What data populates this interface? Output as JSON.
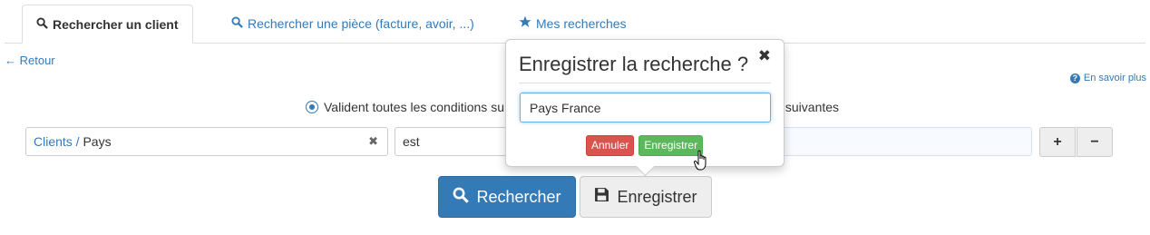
{
  "tabs": [
    {
      "label": "Rechercher un client",
      "icon": "search-icon",
      "active": true
    },
    {
      "label": "Rechercher une pièce (facture, avoir, ...)",
      "icon": "search-icon",
      "active": false
    },
    {
      "label": "Mes recherches",
      "icon": "star-icon",
      "active": false
    }
  ],
  "back_link": "← Retour",
  "help_link": "En savoir plus",
  "conditions": {
    "text_left": "Valident toutes les conditions su",
    "text_right": "s suivantes"
  },
  "criteria_row": {
    "field_link": "Clients",
    "field_sep": " / ",
    "field_name": "Pays",
    "clear_symbol": "✖",
    "operator": "est",
    "plus_label": "+",
    "minus_label": "−"
  },
  "actions": {
    "search_label": "Rechercher",
    "save_label": "Enregistrer"
  },
  "popover": {
    "title": "Enregistrer la recherche ?",
    "close_symbol": "✖",
    "input_value": "Pays France",
    "cancel_label": "Annuler",
    "confirm_label": "Enregistrer"
  },
  "colors": {
    "primary": "#337ab7",
    "danger": "#d9534f",
    "success": "#5cb85c"
  }
}
